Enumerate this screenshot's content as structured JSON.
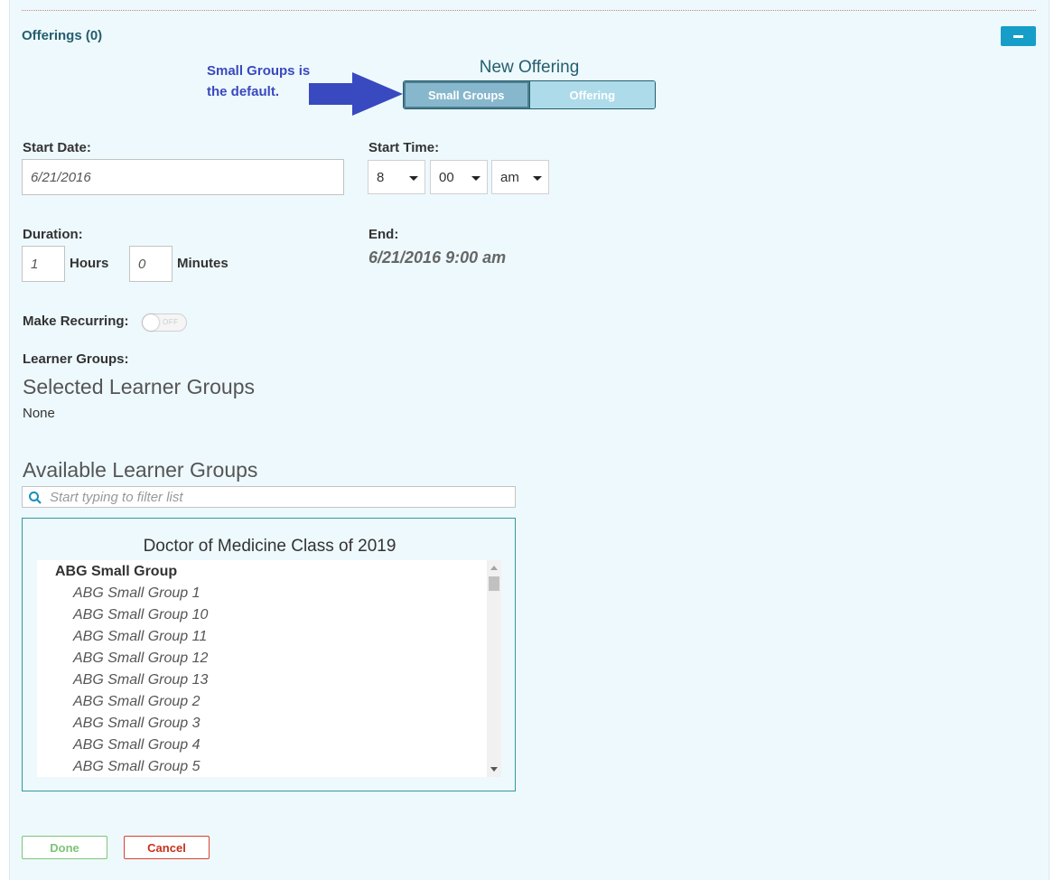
{
  "offerings": {
    "title": "Offerings (0)"
  },
  "callout": {
    "line1": "Small Groups is",
    "line2": "the default."
  },
  "new_offering": {
    "title": "New Offering",
    "modes": [
      {
        "label": "Small Groups",
        "active": true
      },
      {
        "label": "Offering",
        "active": false
      }
    ]
  },
  "form": {
    "start_date_label": "Start Date:",
    "start_date_value": "6/21/2016",
    "start_time_label": "Start Time:",
    "hour": "8",
    "minute": "00",
    "ampm": "am",
    "duration_label": "Duration:",
    "hours_value": "1",
    "hours_label": "Hours",
    "minutes_value": "0",
    "minutes_label": "Minutes",
    "end_label": "End:",
    "end_value": "6/21/2016 9:00 am",
    "recurring_label": "Make Recurring:",
    "recurring_state": "OFF",
    "learner_groups_label": "Learner Groups:"
  },
  "selected_groups": {
    "heading": "Selected Learner Groups",
    "empty_text": "None"
  },
  "available_groups": {
    "heading": "Available Learner Groups",
    "filter_placeholder": "Start typing to filter list",
    "cohort": "Doctor of Medicine Class of 2019",
    "parent": "ABG Small Group",
    "children": [
      "ABG Small Group 1",
      "ABG Small Group 10",
      "ABG Small Group 11",
      "ABG Small Group 12",
      "ABG Small Group 13",
      "ABG Small Group 2",
      "ABG Small Group 3",
      "ABG Small Group 4",
      "ABG Small Group 5"
    ]
  },
  "actions": {
    "done": "Done",
    "cancel": "Cancel"
  },
  "colors": {
    "accent": "#169ec9",
    "callout": "#3949bf",
    "done": "#7cc576",
    "cancel": "#d9412e",
    "panel": "#eef9fd"
  },
  "icons": [
    "minus-icon",
    "arrow-right-icon",
    "search-icon",
    "caret-down-icon"
  ]
}
